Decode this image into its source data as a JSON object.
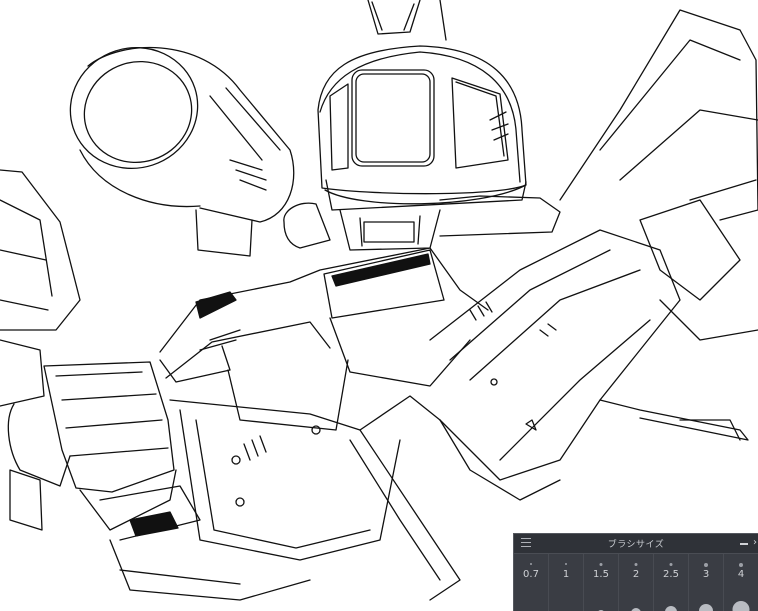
{
  "brush_panel": {
    "title": "ブラシサイズ",
    "menu_icon": "hamburger-menu-icon",
    "minimize_icon": "minimize-icon",
    "close_icon": "close-icon",
    "sizes": [
      {
        "label": "0.7"
      },
      {
        "label": "1"
      },
      {
        "label": "1.5"
      },
      {
        "label": "2"
      },
      {
        "label": "2.5"
      },
      {
        "label": "3"
      },
      {
        "label": "4"
      }
    ]
  },
  "colors": {
    "canvas_background": "#ffffff",
    "line_ink": "#111111",
    "panel_background": "#3a3d44",
    "panel_titlebar": "#2f3238",
    "panel_text": "#cfd1d5"
  }
}
